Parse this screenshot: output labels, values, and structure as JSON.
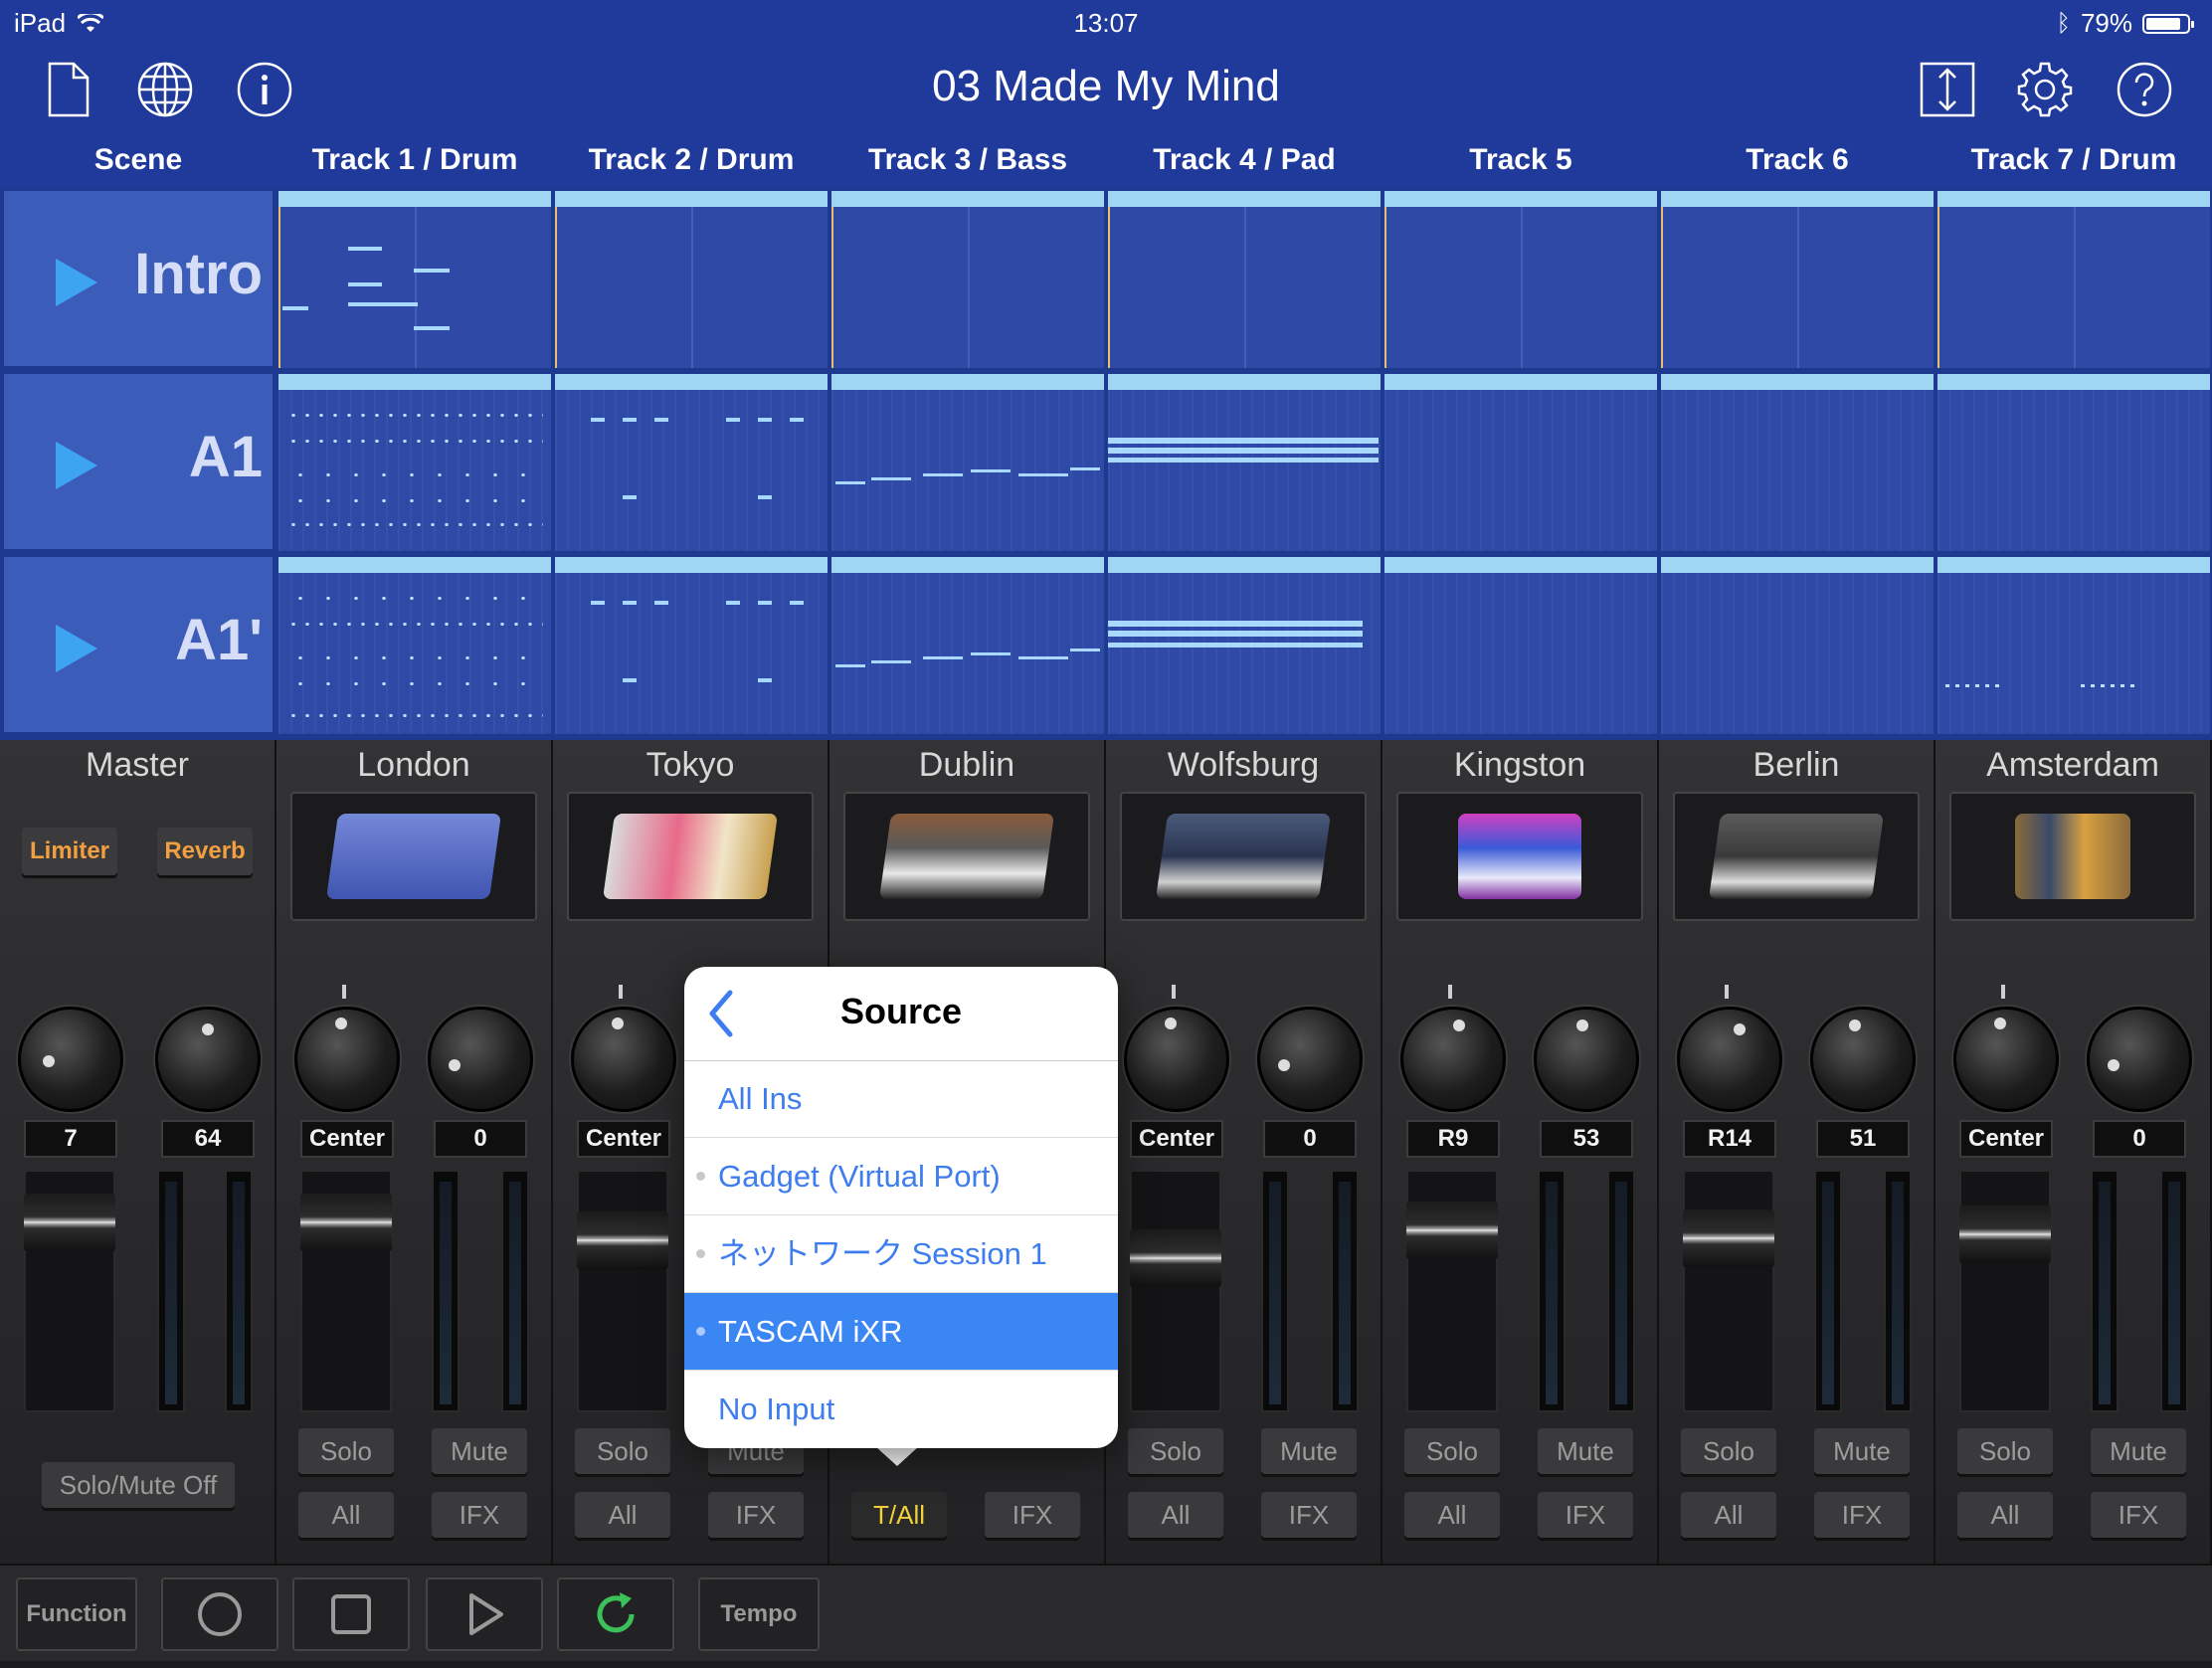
{
  "status_bar": {
    "device": "iPad",
    "time": "13:07",
    "battery_pct": "79%",
    "battery_level": 0.79
  },
  "header": {
    "title": "03 Made My Mind"
  },
  "track_headers": [
    "Scene",
    "Track 1 / Drum",
    "Track 2 / Drum",
    "Track 3 / Bass",
    "Track 4 / Pad",
    "Track 5",
    "Track 6",
    "Track 7 / Drum"
  ],
  "scenes": [
    "Intro",
    "A1",
    "A1'"
  ],
  "mixer": {
    "master": {
      "name": "Master",
      "limiter": "Limiter",
      "reverb": "Reverb",
      "knob1": "7",
      "knob2": "64",
      "solo_mute_off": "Solo/Mute Off"
    },
    "strips": [
      {
        "name": "London",
        "pan": "Center",
        "send": "0",
        "solo": "Solo",
        "mute": "Mute",
        "input": "All",
        "fx": "IFX"
      },
      {
        "name": "Tokyo",
        "pan": "Center",
        "send": "",
        "solo": "Solo",
        "mute": "Mute",
        "input": "All",
        "fx": "IFX"
      },
      {
        "name": "Dublin",
        "pan": "",
        "send": "",
        "solo": "",
        "mute": "Mute",
        "input": "T/All",
        "fx": "IFX"
      },
      {
        "name": "Wolfsburg",
        "pan": "Center",
        "send": "0",
        "solo": "Solo",
        "mute": "Mute",
        "input": "All",
        "fx": "IFX"
      },
      {
        "name": "Kingston",
        "pan": "R9",
        "send": "53",
        "solo": "Solo",
        "mute": "Mute",
        "input": "All",
        "fx": "IFX"
      },
      {
        "name": "Berlin",
        "pan": "R14",
        "send": "51",
        "solo": "Solo",
        "mute": "Mute",
        "input": "All",
        "fx": "IFX"
      },
      {
        "name": "Amsterdam",
        "pan": "Center",
        "send": "0",
        "solo": "Solo",
        "mute": "Mute",
        "input": "All",
        "fx": "IFX"
      }
    ]
  },
  "transport": {
    "function": "Function",
    "tempo": "Tempo"
  },
  "source_popover": {
    "title": "Source",
    "items": [
      "All Ins",
      "Gadget (Virtual Port)",
      "ネットワーク Session 1",
      "TASCAM iXR",
      "No Input"
    ],
    "selected": "TASCAM iXR"
  },
  "colors": {
    "header_bg": "#1f3a9a",
    "accent_play": "#3da4f2",
    "selection": "#3a86f2",
    "fx_button_text": "#f0a040",
    "active_input": "#f2d03a"
  }
}
